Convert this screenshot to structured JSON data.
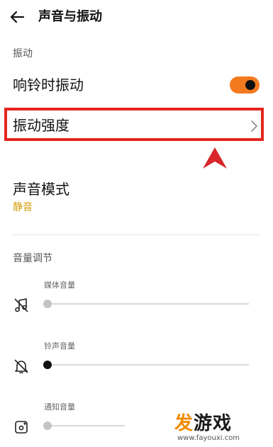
{
  "header": {
    "title": "声音与振动"
  },
  "vibration": {
    "section_label": "振动",
    "ring_vibrate": {
      "label": "响铃时振动",
      "enabled": true
    },
    "intensity_label": "振动强度"
  },
  "sound_mode": {
    "label": "声音模式",
    "value": "静音"
  },
  "volume": {
    "section_label": "音量调节",
    "sliders": [
      {
        "label": "媒体音量",
        "icon": "music-off-icon",
        "level": 0.0,
        "active": false
      },
      {
        "label": "铃声音量",
        "icon": "bell-off-icon",
        "level": 0.0,
        "active": true
      },
      {
        "label": "通知音量",
        "icon": "notification-icon",
        "level": 0.0,
        "active": false
      }
    ]
  },
  "watermark": {
    "logo": "发游戏",
    "url": "www.fayouxi.com"
  },
  "colors": {
    "accent_orange": "#f47a1f",
    "highlight_red": "#e52520",
    "mode_gold": "#d39a00",
    "watermark_orange": "#f08a00",
    "watermark_dark": "#1a1a1a"
  }
}
